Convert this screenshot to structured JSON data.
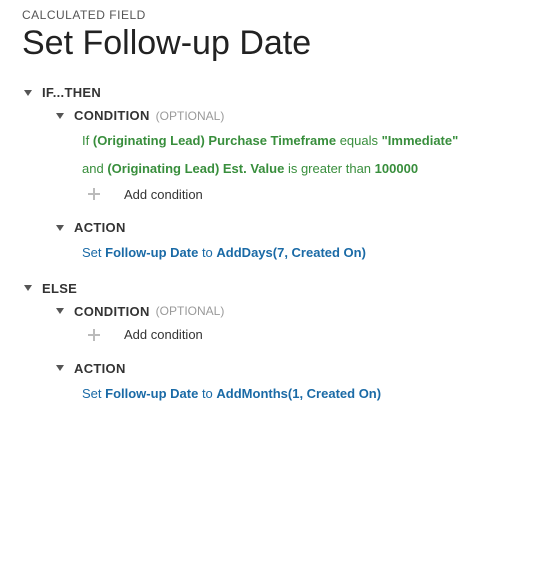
{
  "meta_label": "CALCULATED FIELD",
  "title": "Set Follow-up Date",
  "add_condition_label": "Add condition",
  "labels": {
    "if_then": "IF...THEN",
    "else": "ELSE",
    "condition": "CONDITION",
    "optional": "(OPTIONAL)",
    "action": "ACTION"
  },
  "if_block": {
    "cond1": {
      "prefix": "If",
      "field": "(Originating Lead) Purchase Timeframe",
      "op": "equals",
      "value": "\"Immediate\""
    },
    "cond2": {
      "prefix": "and",
      "field": "(Originating Lead) Est. Value",
      "op": "is greater than",
      "value": "100000"
    },
    "action": {
      "prefix": "Set",
      "target": "Follow-up Date",
      "mid": "to",
      "func": "AddDays(7, Created On)"
    }
  },
  "else_block": {
    "action": {
      "prefix": "Set",
      "target": "Follow-up Date",
      "mid": "to",
      "func": "AddMonths(1, Created On)"
    }
  }
}
